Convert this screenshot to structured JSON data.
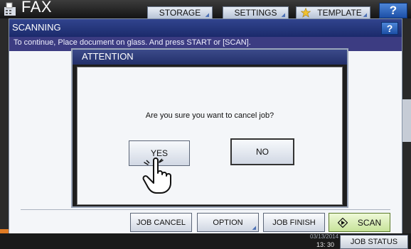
{
  "app": {
    "title": "FAX"
  },
  "top_tabs": {
    "storage": "STORAGE",
    "settings": "SETTINGS",
    "template": "TEMPLATE",
    "help": "?"
  },
  "panel": {
    "title": "SCANNING",
    "help": "?",
    "message": "To continue, Place document on glass. And press START or [SCAN]."
  },
  "panel_buttons": {
    "job_cancel": "JOB CANCEL",
    "option": "OPTION",
    "job_finish": "JOB FINISH",
    "scan": "SCAN"
  },
  "dialog": {
    "title": "ATTENTION",
    "question": "Are you sure you want to cancel job?",
    "yes": "YES",
    "no": "NO"
  },
  "status": {
    "date": "03/13/2014",
    "time": "13: 30",
    "job_status": "JOB STATUS"
  },
  "icons": [
    "fax-icon",
    "star-icon",
    "scan-icon",
    "hand-pointer-icon"
  ],
  "colors": {
    "header_blue": "#23306a",
    "scan_green": "#c7e39a",
    "accent_orange": "#e07b24"
  }
}
